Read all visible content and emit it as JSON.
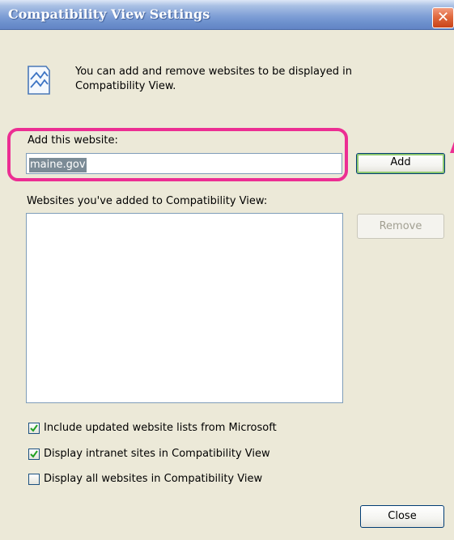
{
  "window": {
    "title": "Compatibility View Settings",
    "close_glyph": "✕"
  },
  "info": {
    "icon": "compatibility-view-icon",
    "text": "You can add and remove websites to be displayed in Compatibility View."
  },
  "add_website": {
    "label": "Add this website:",
    "value": "maine.gov",
    "add_label": "Add"
  },
  "sites_list": {
    "label": "Websites you've added to Compatibility View:",
    "items": [],
    "remove_label": "Remove"
  },
  "options": [
    {
      "label": "Include updated website lists from Microsoft",
      "checked": true
    },
    {
      "label": "Display intranet sites in Compatibility View",
      "checked": true
    },
    {
      "label": "Display all websites in Compatibility View",
      "checked": false
    }
  ],
  "footer": {
    "close_label": "Close"
  },
  "colors": {
    "highlight": "#ec2e93",
    "titlebar": "#7f9fd6",
    "dialog_bg": "#ece9d8"
  }
}
